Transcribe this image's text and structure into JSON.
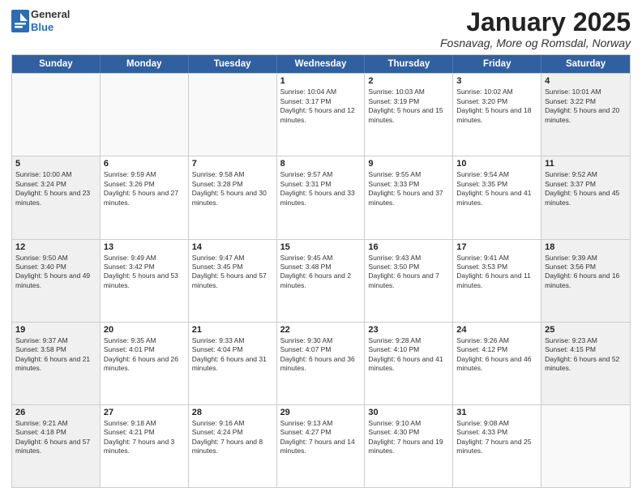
{
  "header": {
    "logo": {
      "general": "General",
      "blue": "Blue"
    },
    "title": "January 2025",
    "location": "Fosnavag, More og Romsdal, Norway"
  },
  "calendar": {
    "days_of_week": [
      "Sunday",
      "Monday",
      "Tuesday",
      "Wednesday",
      "Thursday",
      "Friday",
      "Saturday"
    ],
    "weeks": [
      [
        {
          "day": "",
          "empty": true
        },
        {
          "day": "",
          "empty": true
        },
        {
          "day": "",
          "empty": true
        },
        {
          "day": "1",
          "sunrise": "Sunrise: 10:04 AM",
          "sunset": "Sunset: 3:17 PM",
          "daylight": "Daylight: 5 hours and 12 minutes."
        },
        {
          "day": "2",
          "sunrise": "Sunrise: 10:03 AM",
          "sunset": "Sunset: 3:19 PM",
          "daylight": "Daylight: 5 hours and 15 minutes."
        },
        {
          "day": "3",
          "sunrise": "Sunrise: 10:02 AM",
          "sunset": "Sunset: 3:20 PM",
          "daylight": "Daylight: 5 hours and 18 minutes."
        },
        {
          "day": "4",
          "sunrise": "Sunrise: 10:01 AM",
          "sunset": "Sunset: 3:22 PM",
          "daylight": "Daylight: 5 hours and 20 minutes.",
          "shaded": true
        }
      ],
      [
        {
          "day": "5",
          "sunrise": "Sunrise: 10:00 AM",
          "sunset": "Sunset: 3:24 PM",
          "daylight": "Daylight: 5 hours and 23 minutes.",
          "shaded": true
        },
        {
          "day": "6",
          "sunrise": "Sunrise: 9:59 AM",
          "sunset": "Sunset: 3:26 PM",
          "daylight": "Daylight: 5 hours and 27 minutes."
        },
        {
          "day": "7",
          "sunrise": "Sunrise: 9:58 AM",
          "sunset": "Sunset: 3:28 PM",
          "daylight": "Daylight: 5 hours and 30 minutes."
        },
        {
          "day": "8",
          "sunrise": "Sunrise: 9:57 AM",
          "sunset": "Sunset: 3:31 PM",
          "daylight": "Daylight: 5 hours and 33 minutes."
        },
        {
          "day": "9",
          "sunrise": "Sunrise: 9:55 AM",
          "sunset": "Sunset: 3:33 PM",
          "daylight": "Daylight: 5 hours and 37 minutes."
        },
        {
          "day": "10",
          "sunrise": "Sunrise: 9:54 AM",
          "sunset": "Sunset: 3:35 PM",
          "daylight": "Daylight: 5 hours and 41 minutes."
        },
        {
          "day": "11",
          "sunrise": "Sunrise: 9:52 AM",
          "sunset": "Sunset: 3:37 PM",
          "daylight": "Daylight: 5 hours and 45 minutes.",
          "shaded": true
        }
      ],
      [
        {
          "day": "12",
          "sunrise": "Sunrise: 9:50 AM",
          "sunset": "Sunset: 3:40 PM",
          "daylight": "Daylight: 5 hours and 49 minutes.",
          "shaded": true
        },
        {
          "day": "13",
          "sunrise": "Sunrise: 9:49 AM",
          "sunset": "Sunset: 3:42 PM",
          "daylight": "Daylight: 5 hours and 53 minutes."
        },
        {
          "day": "14",
          "sunrise": "Sunrise: 9:47 AM",
          "sunset": "Sunset: 3:45 PM",
          "daylight": "Daylight: 5 hours and 57 minutes."
        },
        {
          "day": "15",
          "sunrise": "Sunrise: 9:45 AM",
          "sunset": "Sunset: 3:48 PM",
          "daylight": "Daylight: 6 hours and 2 minutes."
        },
        {
          "day": "16",
          "sunrise": "Sunrise: 9:43 AM",
          "sunset": "Sunset: 3:50 PM",
          "daylight": "Daylight: 6 hours and 7 minutes."
        },
        {
          "day": "17",
          "sunrise": "Sunrise: 9:41 AM",
          "sunset": "Sunset: 3:53 PM",
          "daylight": "Daylight: 6 hours and 11 minutes."
        },
        {
          "day": "18",
          "sunrise": "Sunrise: 9:39 AM",
          "sunset": "Sunset: 3:56 PM",
          "daylight": "Daylight: 6 hours and 16 minutes.",
          "shaded": true
        }
      ],
      [
        {
          "day": "19",
          "sunrise": "Sunrise: 9:37 AM",
          "sunset": "Sunset: 3:58 PM",
          "daylight": "Daylight: 6 hours and 21 minutes.",
          "shaded": true
        },
        {
          "day": "20",
          "sunrise": "Sunrise: 9:35 AM",
          "sunset": "Sunset: 4:01 PM",
          "daylight": "Daylight: 6 hours and 26 minutes."
        },
        {
          "day": "21",
          "sunrise": "Sunrise: 9:33 AM",
          "sunset": "Sunset: 4:04 PM",
          "daylight": "Daylight: 6 hours and 31 minutes."
        },
        {
          "day": "22",
          "sunrise": "Sunrise: 9:30 AM",
          "sunset": "Sunset: 4:07 PM",
          "daylight": "Daylight: 6 hours and 36 minutes."
        },
        {
          "day": "23",
          "sunrise": "Sunrise: 9:28 AM",
          "sunset": "Sunset: 4:10 PM",
          "daylight": "Daylight: 6 hours and 41 minutes."
        },
        {
          "day": "24",
          "sunrise": "Sunrise: 9:26 AM",
          "sunset": "Sunset: 4:12 PM",
          "daylight": "Daylight: 6 hours and 46 minutes."
        },
        {
          "day": "25",
          "sunrise": "Sunrise: 9:23 AM",
          "sunset": "Sunset: 4:15 PM",
          "daylight": "Daylight: 6 hours and 52 minutes.",
          "shaded": true
        }
      ],
      [
        {
          "day": "26",
          "sunrise": "Sunrise: 9:21 AM",
          "sunset": "Sunset: 4:18 PM",
          "daylight": "Daylight: 6 hours and 57 minutes.",
          "shaded": true
        },
        {
          "day": "27",
          "sunrise": "Sunrise: 9:18 AM",
          "sunset": "Sunset: 4:21 PM",
          "daylight": "Daylight: 7 hours and 3 minutes."
        },
        {
          "day": "28",
          "sunrise": "Sunrise: 9:16 AM",
          "sunset": "Sunset: 4:24 PM",
          "daylight": "Daylight: 7 hours and 8 minutes."
        },
        {
          "day": "29",
          "sunrise": "Sunrise: 9:13 AM",
          "sunset": "Sunset: 4:27 PM",
          "daylight": "Daylight: 7 hours and 14 minutes."
        },
        {
          "day": "30",
          "sunrise": "Sunrise: 9:10 AM",
          "sunset": "Sunset: 4:30 PM",
          "daylight": "Daylight: 7 hours and 19 minutes."
        },
        {
          "day": "31",
          "sunrise": "Sunrise: 9:08 AM",
          "sunset": "Sunset: 4:33 PM",
          "daylight": "Daylight: 7 hours and 25 minutes."
        },
        {
          "day": "",
          "empty": true,
          "shaded": true
        }
      ]
    ]
  }
}
